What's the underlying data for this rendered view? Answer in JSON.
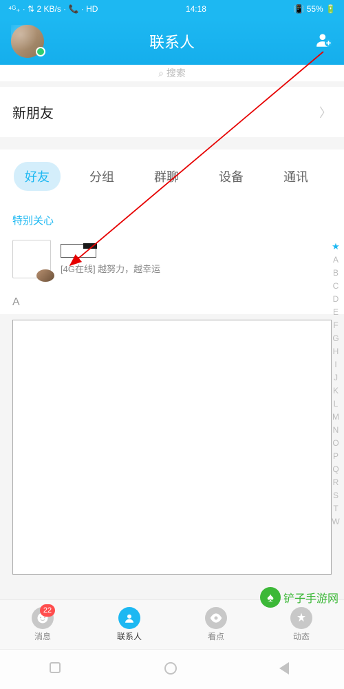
{
  "status": {
    "left": "⁴ᴳ₊ · ⇅ 2 KB/s · 📞 · HD",
    "time": "14:18",
    "right": "📳 55% 🔋"
  },
  "header": {
    "title": "联系人"
  },
  "search": {
    "placeholder": "搜索"
  },
  "new_friends": {
    "label": "新朋友"
  },
  "tabs": [
    {
      "label": "好友",
      "active": true
    },
    {
      "label": "分组",
      "active": false
    },
    {
      "label": "群聊",
      "active": false
    },
    {
      "label": "设备",
      "active": false
    },
    {
      "label": "通讯",
      "active": false
    }
  ],
  "sections": {
    "special": {
      "title": "特别关心",
      "contact_status": "[4G在线] 越努力，越幸运"
    },
    "letter_a": "A"
  },
  "alpha_index": [
    "★",
    "A",
    "B",
    "C",
    "D",
    "E",
    "F",
    "G",
    "H",
    "I",
    "J",
    "K",
    "L",
    "M",
    "N",
    "O",
    "P",
    "Q",
    "R",
    "S",
    "T",
    "W"
  ],
  "bottom_nav": [
    {
      "label": "消息",
      "badge": "22"
    },
    {
      "label": "联系人",
      "active": true
    },
    {
      "label": "看点"
    },
    {
      "label": "动态"
    }
  ],
  "watermark": {
    "icon": "♠",
    "text": "铲子手游网",
    "url": "czjcw.com"
  }
}
